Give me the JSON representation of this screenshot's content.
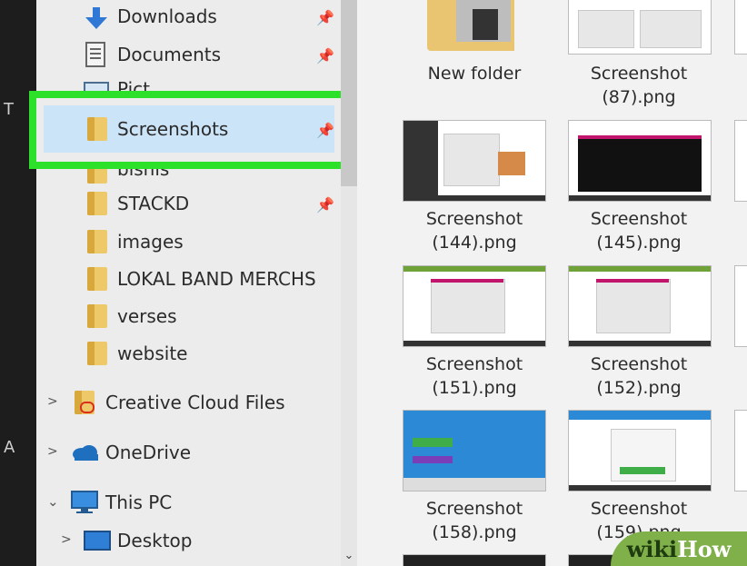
{
  "colors": {
    "highlight": "#2de02a",
    "selection": "#cce4f7",
    "folder": "#eec96a"
  },
  "left_edge_letters": [
    "T",
    "A"
  ],
  "quick_access": [
    {
      "label": "Downloads",
      "icon": "download-arrow-icon",
      "pinned": true
    },
    {
      "label": "Documents",
      "icon": "document-icon",
      "pinned": true
    },
    {
      "label": "Pict",
      "icon": "pictures-icon",
      "pinned": true
    },
    {
      "label": "Screenshots",
      "icon": "folder-icon",
      "pinned": true,
      "selected": true
    },
    {
      "label": "bisnis",
      "icon": "folder-icon",
      "pinned": true
    },
    {
      "label": "STACKD",
      "icon": "folder-icon",
      "pinned": true
    },
    {
      "label": "images",
      "icon": "folder-icon",
      "pinned": false
    },
    {
      "label": "LOKAL BAND MERCHS",
      "icon": "folder-icon",
      "pinned": false
    },
    {
      "label": "verses",
      "icon": "folder-icon",
      "pinned": false
    },
    {
      "label": "website",
      "icon": "folder-icon",
      "pinned": false
    }
  ],
  "roots": [
    {
      "label": "Creative Cloud Files",
      "icon": "creative-cloud-icon"
    },
    {
      "label": "OneDrive",
      "icon": "cloud-icon"
    },
    {
      "label": "This PC",
      "icon": "computer-icon"
    },
    {
      "label": "Desktop",
      "icon": "desktop-icon"
    }
  ],
  "files": [
    {
      "name": "New folder"
    },
    {
      "name": "Screenshot (87).png"
    },
    {
      "name": "Screenshot (144).png"
    },
    {
      "name": "Screenshot (145).png"
    },
    {
      "name": "Screenshot (151).png"
    },
    {
      "name": "Screenshot (152).png"
    },
    {
      "name": "Screenshot (158).png"
    },
    {
      "name": "Screenshot (159).png"
    }
  ],
  "captions": {
    "f0": "New folder",
    "f1a": "Screenshot",
    "f1b": "(87).png",
    "f2a": "Screenshot",
    "f2b": "(144).png",
    "f3a": "Screenshot",
    "f3b": "(145).png",
    "f4a": "Screenshot",
    "f4b": "(151).png",
    "f5a": "Screenshot",
    "f5b": "(152).png",
    "f6a": "Screenshot",
    "f6b": "(158).png",
    "f7a": "Screenshot",
    "f7b": "(159).png"
  },
  "watermark": {
    "part1": "wiki",
    "part2": "How"
  }
}
